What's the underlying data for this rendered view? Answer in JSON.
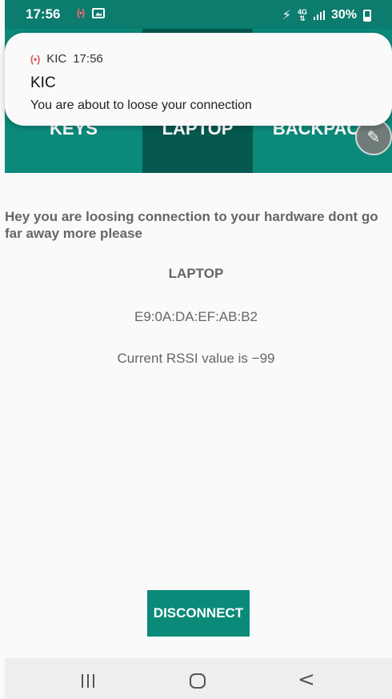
{
  "status_bar": {
    "time": "17:56",
    "battery": "30%",
    "network": "4G"
  },
  "notification": {
    "app_name": "KIC",
    "time": "17:56",
    "title": "KIC",
    "body": "You are about to loose your connection"
  },
  "tabs": [
    {
      "label": "KEYS"
    },
    {
      "label": "LAPTOP"
    },
    {
      "label": "BACKPACK"
    }
  ],
  "main": {
    "warning": "Hey you are loosing connection to your hardware dont go far away more please",
    "device_name": "LAPTOP",
    "mac_address": "E9:0A:DA:EF:AB:B2",
    "rssi": "Current RSSI value is −99",
    "disconnect_label": "DISCONNECT"
  },
  "colors": {
    "primary": "#0b8a7a",
    "primary_dark": "#06594f"
  }
}
